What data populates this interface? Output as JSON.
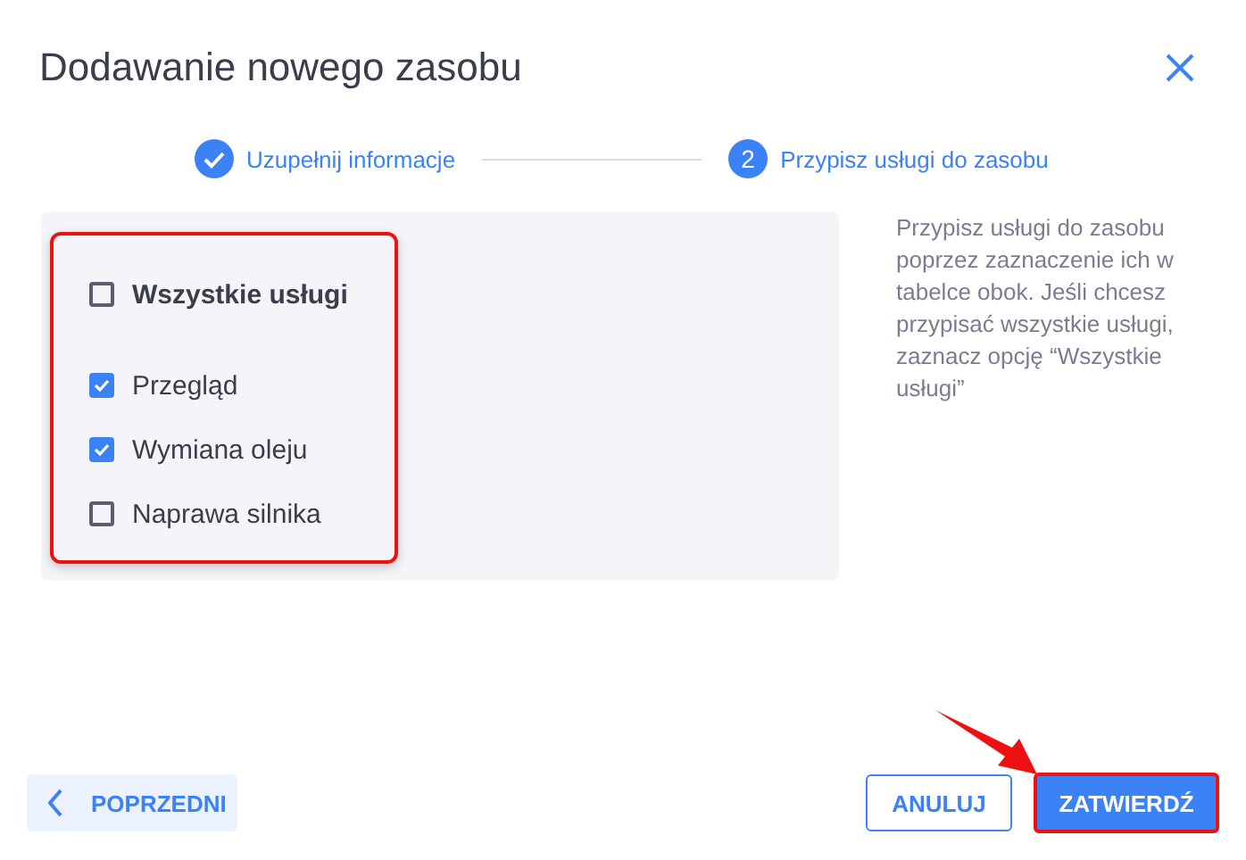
{
  "dialog": {
    "title": "Dodawanie nowego zasobu"
  },
  "steps": [
    {
      "label": "Uzupełnij informacje",
      "completed": true
    },
    {
      "label": "Przypisz usługi do zasobu",
      "completed": false,
      "number": "2"
    }
  ],
  "services": [
    {
      "label": "Wszystkie usługi",
      "kind": "all",
      "checked": false
    },
    {
      "label": "Przegląd",
      "kind": "item",
      "checked": true
    },
    {
      "label": "Wymiana oleju",
      "kind": "item",
      "checked": true
    },
    {
      "label": "Naprawa silnika",
      "kind": "item",
      "checked": false
    }
  ],
  "hint": "Przypisz usługi do zasobu poprzez zaznaczenie ich w tabelce obok. Jeśli chcesz przypisać wszystkie usługi, zaznacz opcję “Wszystkie usługi”",
  "buttons": {
    "previous": "POPRZEDNI",
    "cancel": "ANULUJ",
    "confirm": "ZATWIERDŹ"
  }
}
